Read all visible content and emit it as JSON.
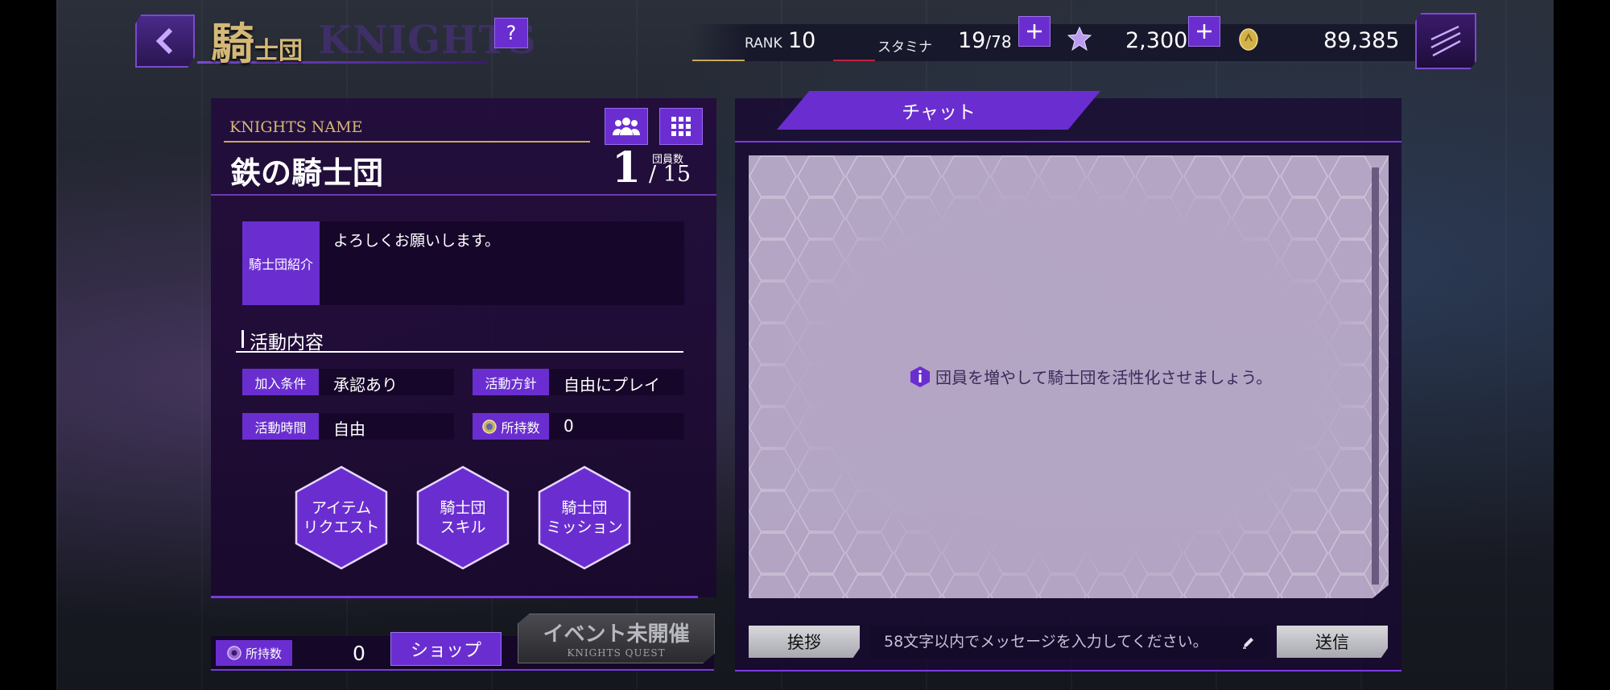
{
  "header": {
    "title_jp_big": "騎",
    "title_jp_small": "士団",
    "title_en": "KNIGHTS",
    "help_label": "?"
  },
  "status": {
    "rank_label": "RANK",
    "rank_value": "10",
    "stamina_label": "スタミナ",
    "stamina_current": "19",
    "stamina_max": "/78",
    "gems": "2,300",
    "coins": "89,385",
    "colors": {
      "gem": "#b99cf0",
      "coin": "#d4b24a",
      "accent": "#6a2ed0"
    }
  },
  "knights": {
    "name_label": "KNIGHTS NAME",
    "name": "鉄の騎士団",
    "member_count": "1",
    "member_caption": "団員数",
    "member_max": "/ 15",
    "intro_tag": "騎士団紹介",
    "intro_text": "よろしくお願いします。",
    "activity_title": "活動内容",
    "join_label": "加入条件",
    "join_value": "承認あり",
    "policy_label": "活動方針",
    "policy_value": "自由にプレイ",
    "time_label": "活動時間",
    "time_value": "自由",
    "owned_label": "所持数",
    "owned_value": "0"
  },
  "actions": [
    {
      "line1": "アイテム",
      "line2": "リクエスト"
    },
    {
      "line1": "騎士団",
      "line2": "スキル"
    },
    {
      "line1": "騎士団",
      "line2": "ミッション"
    }
  ],
  "footer": {
    "owned_label": "所持数",
    "owned_value": "0",
    "shop_label": "ショップ",
    "event_title": "イベント未開催",
    "event_sub": "KNIGHTS QUEST"
  },
  "chat": {
    "tab_label": "チャット",
    "info_message": "団員を増やして騎士団を活性化させましょう。",
    "greet_label": "挨拶",
    "input_placeholder": "58文字以内でメッセージを入力してください。",
    "send_label": "送信"
  }
}
